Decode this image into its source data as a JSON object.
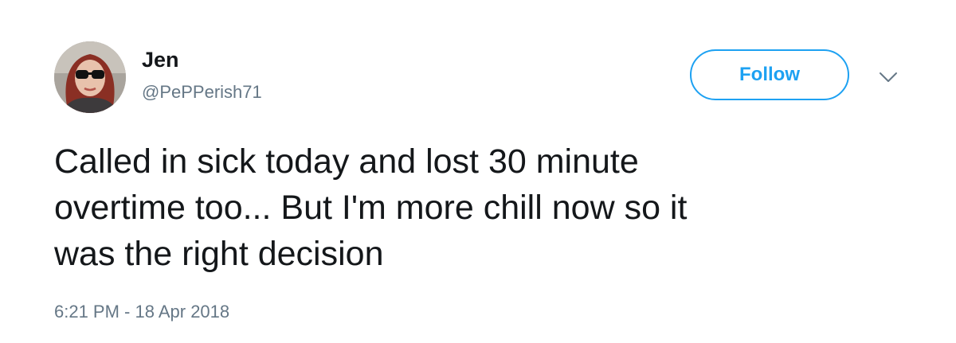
{
  "author": {
    "name": "Jen",
    "handle": "@PePPerish71",
    "avatar": "avatar-photo"
  },
  "actions": {
    "follow_label": "Follow",
    "menu_icon": "chevron-down-icon"
  },
  "tweet": {
    "text": "Called in sick today and lost 30 minute\novertime too... But I'm more chill now so it\nwas the right decision",
    "timestamp": "6:21 PM - 18 Apr 2018"
  },
  "colors": {
    "accent": "#1da1f2",
    "text": "#14171a",
    "secondary": "#657786",
    "background": "#ffffff"
  }
}
